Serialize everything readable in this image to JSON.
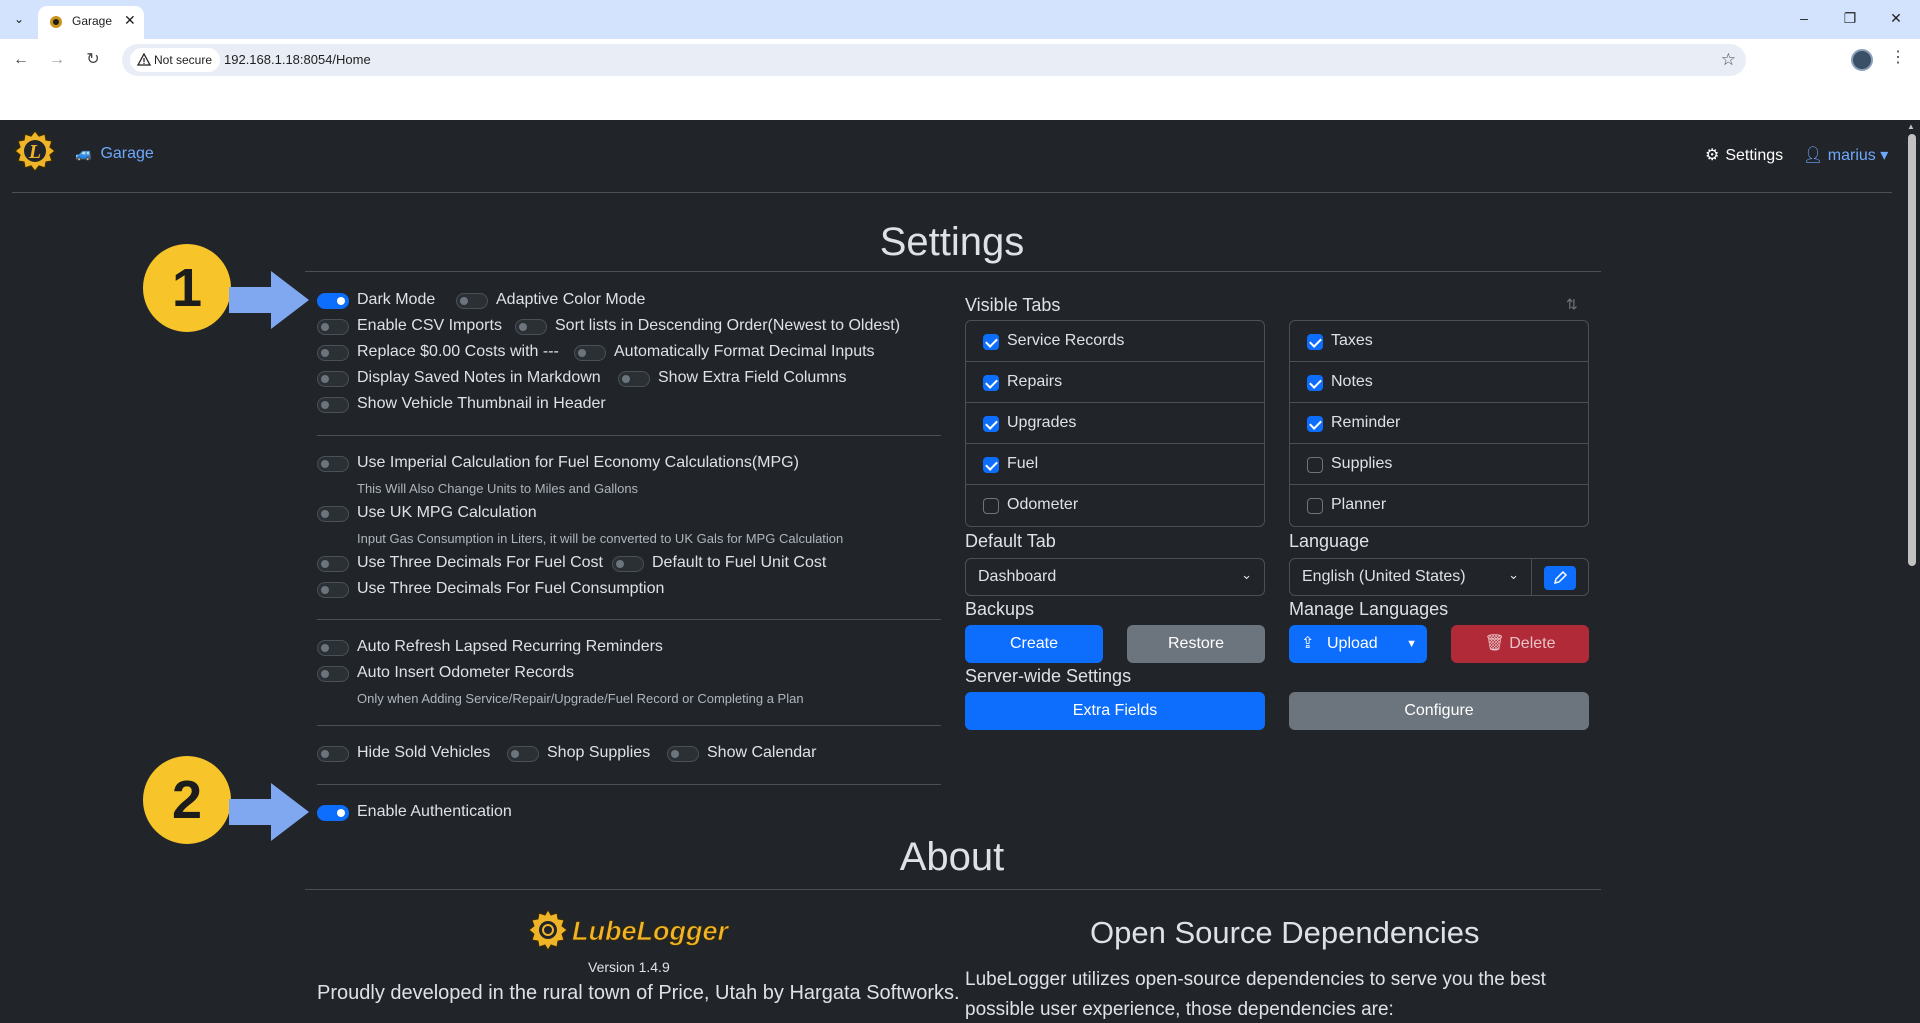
{
  "browser": {
    "tab_title": "Garage",
    "not_secure": "Not secure",
    "url": "192.168.1.18:8054/Home"
  },
  "nav": {
    "garage": "Garage",
    "settings": "Settings",
    "user": "marius"
  },
  "page_title": "Settings",
  "toggles": {
    "dark_mode": "Dark Mode",
    "adaptive_color": "Adaptive Color Mode",
    "csv_imports": "Enable CSV Imports",
    "sort_desc": "Sort lists in Descending Order(Newest to Oldest)",
    "replace_zero": "Replace $0.00 Costs with ---",
    "auto_decimal": "Automatically Format Decimal Inputs",
    "notes_markdown": "Display Saved Notes in Markdown",
    "extra_columns": "Show Extra Field Columns",
    "vehicle_thumb": "Show Vehicle Thumbnail in Header",
    "imperial": "Use Imperial Calculation for Fuel Economy Calculations(MPG)",
    "imperial_hint": "This Will Also Change Units to Miles and Gallons",
    "uk_mpg": "Use UK MPG Calculation",
    "uk_mpg_hint": "Input Gas Consumption in Liters, it will be converted to UK Gals for MPG Calculation",
    "three_dec_cost": "Use Three Decimals For Fuel Cost",
    "fuel_unit_cost": "Default to Fuel Unit Cost",
    "three_dec_consumption": "Use Three Decimals For Fuel Consumption",
    "auto_refresh": "Auto Refresh Lapsed Recurring Reminders",
    "auto_odometer": "Auto Insert Odometer Records",
    "auto_odometer_hint": "Only when Adding Service/Repair/Upgrade/Fuel Record or Completing a Plan",
    "hide_sold": "Hide Sold Vehicles",
    "shop_supplies": "Shop Supplies",
    "show_calendar": "Show Calendar",
    "enable_auth": "Enable Authentication"
  },
  "visible_tabs": {
    "label": "Visible Tabs",
    "left": [
      {
        "label": "Service Records",
        "checked": true
      },
      {
        "label": "Repairs",
        "checked": true
      },
      {
        "label": "Upgrades",
        "checked": true
      },
      {
        "label": "Fuel",
        "checked": true
      },
      {
        "label": "Odometer",
        "checked": false
      }
    ],
    "right": [
      {
        "label": "Taxes",
        "checked": true
      },
      {
        "label": "Notes",
        "checked": true
      },
      {
        "label": "Reminder",
        "checked": true
      },
      {
        "label": "Supplies",
        "checked": false
      },
      {
        "label": "Planner",
        "checked": false
      }
    ]
  },
  "default_tab": {
    "label": "Default Tab",
    "value": "Dashboard"
  },
  "language": {
    "label": "Language",
    "value": "English (United States)"
  },
  "backups": {
    "label": "Backups",
    "create": "Create",
    "restore": "Restore"
  },
  "manage_languages": {
    "label": "Manage Languages",
    "upload": "Upload",
    "delete": "Delete"
  },
  "server_wide": {
    "label": "Server-wide Settings",
    "extra_fields": "Extra Fields",
    "configure": "Configure"
  },
  "annotations": {
    "one": "1",
    "two": "2"
  },
  "about": {
    "title": "About",
    "logo_text": "LubeLogger",
    "version": "Version 1.4.9",
    "proud": "Proudly developed in the rural town of Price, Utah by Hargata Softworks.",
    "osd_title": "Open Source Dependencies",
    "osd_text": "LubeLogger utilizes open-source dependencies to serve you the best possible user experience, those dependencies are:"
  },
  "colors": {
    "background": "#212529",
    "primary": "#0d6efd",
    "secondary": "#6c757d",
    "danger": "#b02a37",
    "link": "#6ea8fe",
    "badge": "#f7c42a",
    "arrow": "#7fa8f0"
  }
}
